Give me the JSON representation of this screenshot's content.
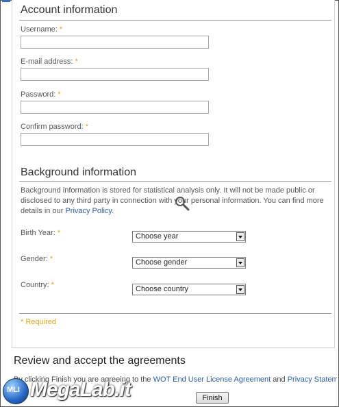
{
  "account": {
    "title": "Account information",
    "username_label": "Username:",
    "email_label": "E-mail address:",
    "password_label": "Password:",
    "confirm_label": "Confirm password:",
    "required_mark": "*",
    "username_value": "",
    "email_value": "",
    "password_value": "",
    "confirm_value": ""
  },
  "background": {
    "title": "Background information",
    "desc_before": "Background information is stored for statistical analysis only. It will not be made public or disclosed to any third party in connection with your personal information. You can find more details in our ",
    "privacy_link": "Privacy Policy",
    "desc_after": ".",
    "birth_label": "Birth Year:",
    "birth_value": "Choose year",
    "gender_label": "Gender:",
    "gender_value": "Choose gender",
    "country_label": "Country:",
    "country_value": "Choose country",
    "required_note": "* Required"
  },
  "agreements": {
    "title": "Review and accept the agreements",
    "text_before": "By clicking Finish you are agreeing to the ",
    "eula_link": "WOT End User License Agreement",
    "text_and": " and ",
    "privacy_link": "Privacy Stateme",
    "finish_label": "Finish"
  },
  "watermark": {
    "text": "MegaLab.it",
    "badge": "MLI"
  },
  "colors": {
    "required": "#e0a419",
    "link": "#2c5ea8"
  }
}
